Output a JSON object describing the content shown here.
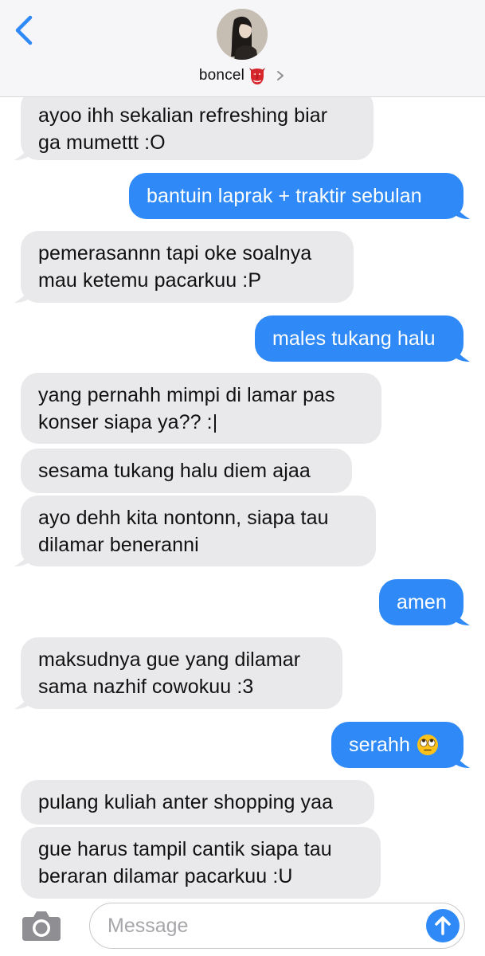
{
  "header": {
    "contact_name": "boncel",
    "contact_emoji": "red-mask-emoji",
    "back_icon": "chevron-left-icon",
    "disclosure_icon": "chevron-right-icon"
  },
  "messages": [
    {
      "direction": "incoming",
      "text": "ayoo ihh sekalian refreshing biar\nga mumettt :O"
    },
    {
      "direction": "outgoing",
      "text": "bantuin laprak + traktir sebulan"
    },
    {
      "direction": "incoming",
      "text": "pemerasannn tapi oke soalnya\nmau ketemu pacarkuu :P"
    },
    {
      "direction": "outgoing",
      "text": "males tukang halu"
    },
    {
      "direction": "incoming",
      "text": "yang pernahh mimpi di lamar pas\nkonser siapa ya?? :|"
    },
    {
      "direction": "incoming",
      "text": "sesama tukang halu diem ajaa"
    },
    {
      "direction": "incoming",
      "text": "ayo dehh kita nontonn, siapa tau\ndilamar beneranni"
    },
    {
      "direction": "outgoing",
      "text": "amen"
    },
    {
      "direction": "incoming",
      "text": "maksudnya gue yang dilamar\nsama nazhif cowokuu :3"
    },
    {
      "direction": "outgoing",
      "text": "serahh",
      "emoji": "eye-roll-emoji"
    },
    {
      "direction": "incoming",
      "text": "pulang kuliah anter shopping yaa"
    },
    {
      "direction": "incoming",
      "text": "gue harus tampil cantik siapa tau\nberaran dilamar pacarkuu :U"
    }
  ],
  "composer": {
    "placeholder": "Message",
    "camera_icon": "camera-icon",
    "send_icon": "arrow-up-icon"
  },
  "colors": {
    "outgoing_bubble": "#2f8af7",
    "incoming_bubble": "#e9e9eb",
    "accent": "#2f8af7"
  }
}
